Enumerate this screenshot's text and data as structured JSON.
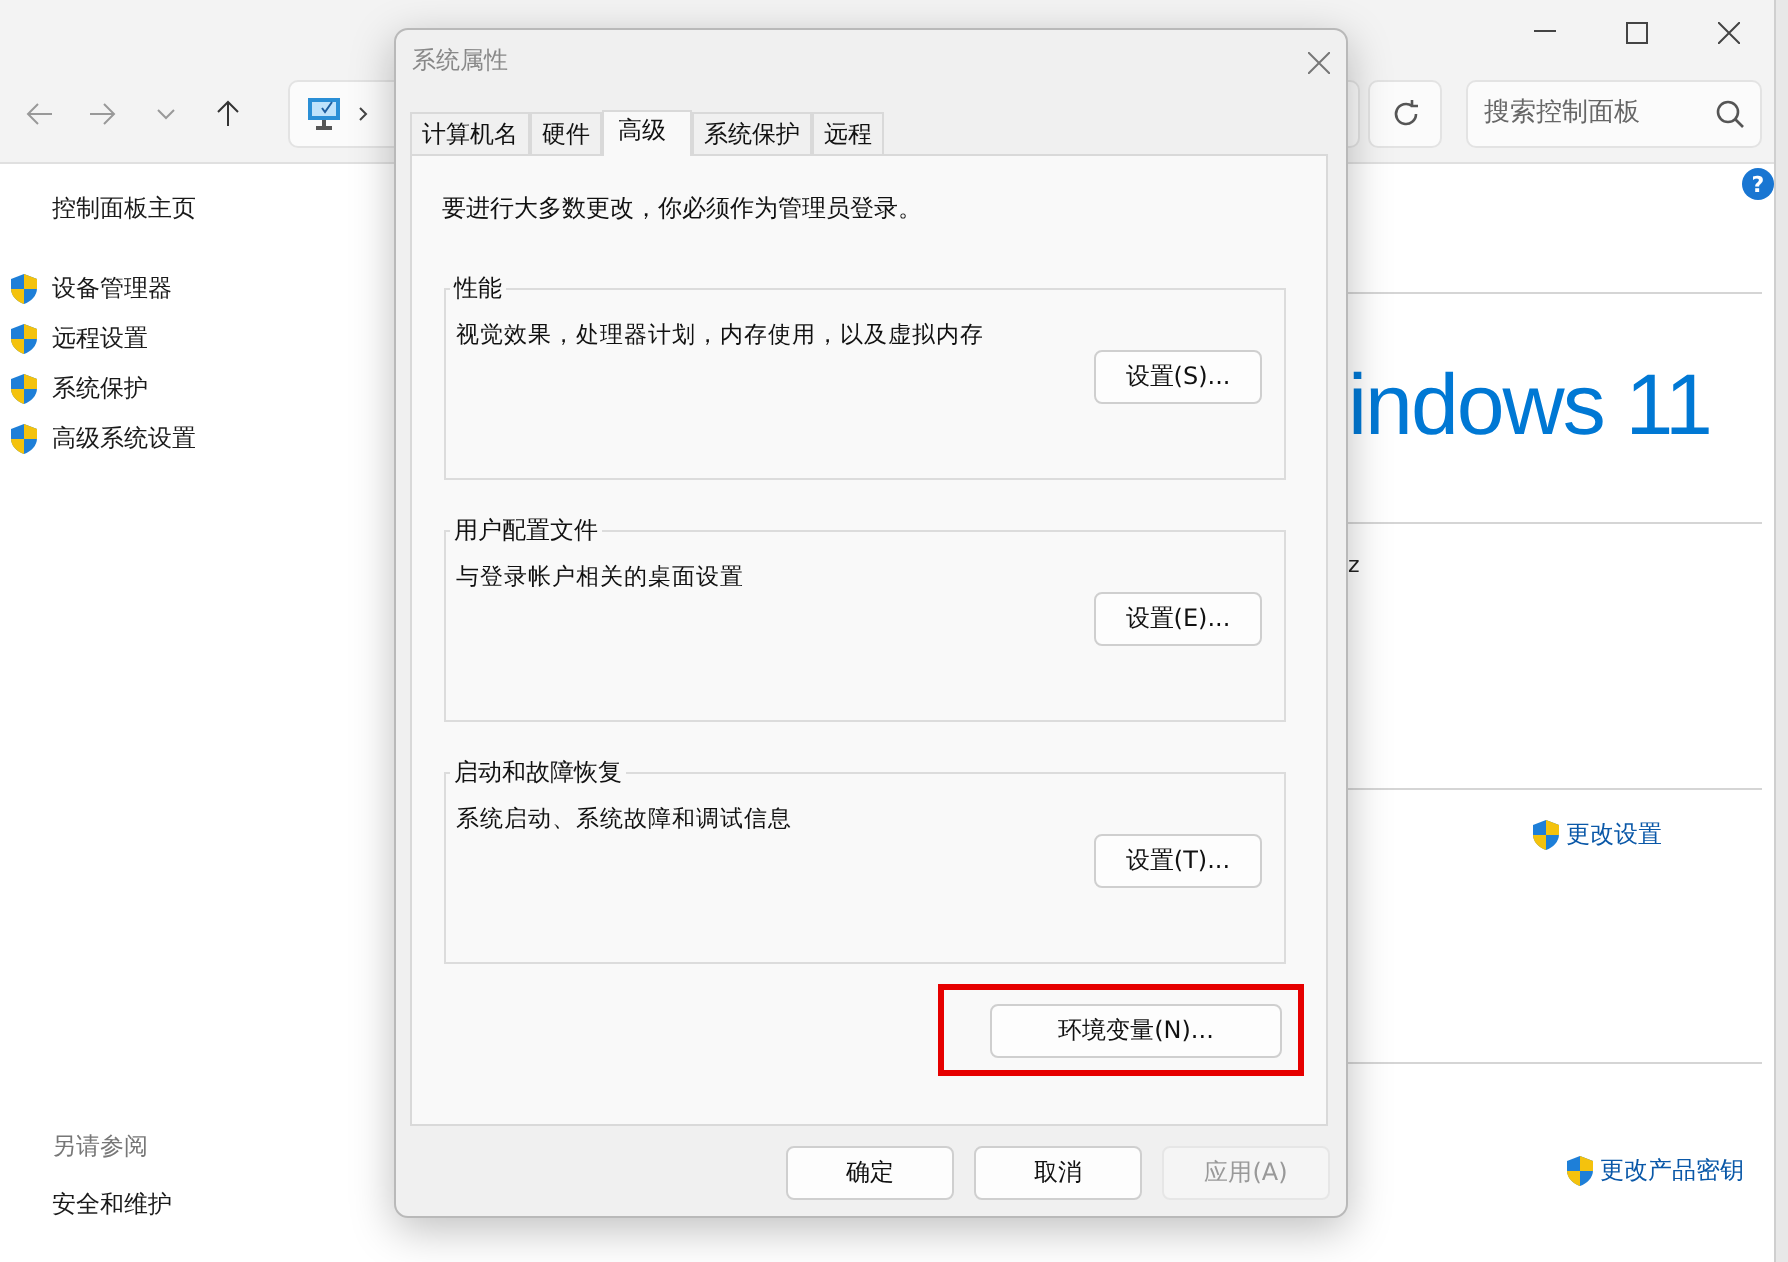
{
  "main_window": {
    "help": "?",
    "search": {
      "placeholder": "搜索控制面板"
    },
    "sidebar": {
      "home": "控制面板主页",
      "items": [
        {
          "label": "设备管理器"
        },
        {
          "label": "远程设置"
        },
        {
          "label": "系统保护"
        },
        {
          "label": "高级系统设置"
        }
      ],
      "see_also_title": "另请参阅",
      "see_also": [
        "安全和维护"
      ]
    },
    "content": {
      "logo": "indows 11",
      "column_2": "z",
      "change_settings": "更改设置",
      "change_key": "更改产品密钥"
    }
  },
  "dialog": {
    "title": "系统属性",
    "tabs": [
      {
        "label": "计算机名",
        "selected": false
      },
      {
        "label": "硬件",
        "selected": false
      },
      {
        "label": "高级",
        "selected": true
      },
      {
        "label": "系统保护",
        "selected": false
      },
      {
        "label": "远程",
        "selected": false
      }
    ],
    "notice": "要进行大多数更改，你必须作为管理员登录。",
    "groups": [
      {
        "title": "性能",
        "description": "视觉效果，处理器计划，内存使用，以及虚拟内存",
        "button": "设置(S)..."
      },
      {
        "title": "用户配置文件",
        "description": "与登录帐户相关的桌面设置",
        "button": "设置(E)..."
      },
      {
        "title": "启动和故障恢复",
        "description": "系统启动、系统故障和调试信息",
        "button": "设置(T)..."
      }
    ],
    "env_button": {
      "label": "环境变量(N)...",
      "highlighted": true
    },
    "buttons": [
      {
        "label": "确定",
        "disabled": false
      },
      {
        "label": "取消",
        "disabled": false
      },
      {
        "label": "应用(A)",
        "disabled": true
      }
    ]
  }
}
